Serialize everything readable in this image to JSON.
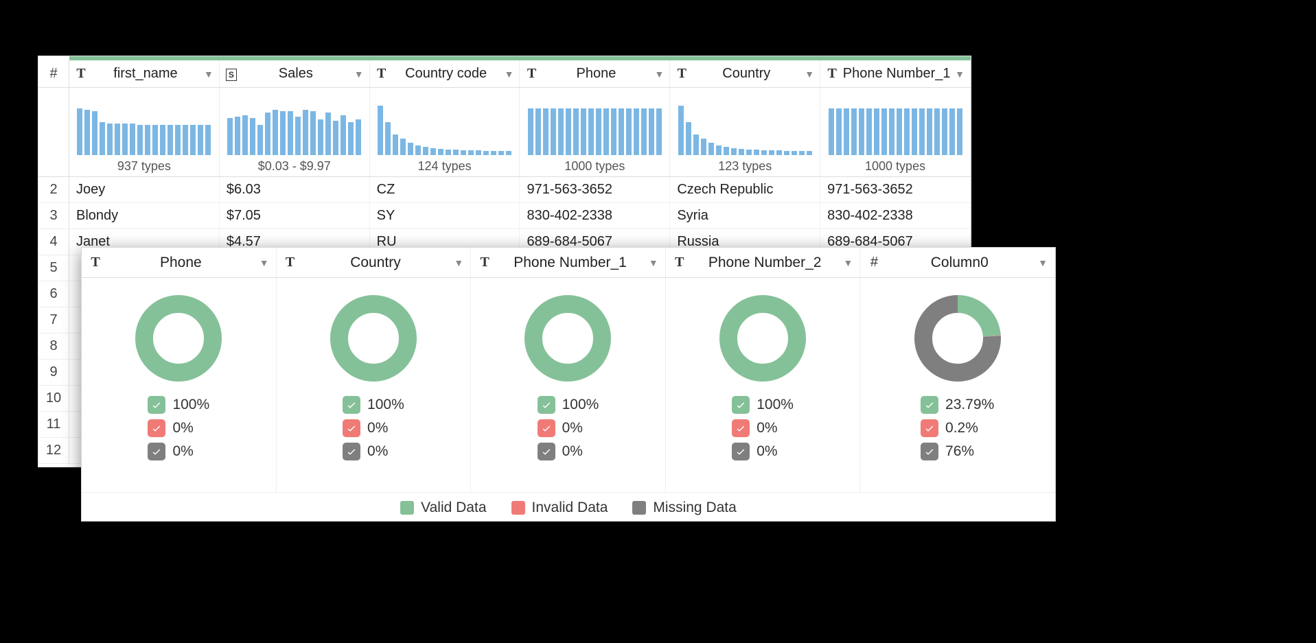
{
  "colors": {
    "valid": "#85c198",
    "invalid": "#f07a75",
    "missing": "#7f7f7f",
    "bar": "#7cb7e4"
  },
  "back": {
    "row_hash": "#",
    "columns": [
      {
        "type": "T",
        "label": "first_name",
        "hist_label": "937 types",
        "hist": [
          68,
          66,
          64,
          48,
          46,
          46,
          46,
          46,
          44,
          44,
          44,
          44,
          44,
          44,
          44,
          44,
          44,
          44
        ]
      },
      {
        "type": "S",
        "label": "Sales",
        "hist_label": "$0.03 - $9.97",
        "hist": [
          54,
          56,
          58,
          54,
          44,
          62,
          66,
          64,
          64,
          56,
          66,
          64,
          52,
          62,
          50,
          58,
          48,
          52
        ]
      },
      {
        "type": "T",
        "label": "Country code",
        "hist_label": "124 types",
        "hist": [
          72,
          48,
          30,
          24,
          18,
          14,
          12,
          10,
          9,
          8,
          8,
          7,
          7,
          7,
          6,
          6,
          6,
          6
        ]
      },
      {
        "type": "T",
        "label": "Phone",
        "hist_label": "1000 types",
        "hist": [
          68,
          68,
          68,
          68,
          68,
          68,
          68,
          68,
          68,
          68,
          68,
          68,
          68,
          68,
          68,
          68,
          68,
          68
        ]
      },
      {
        "type": "T",
        "label": "Country",
        "hist_label": "123 types",
        "hist": [
          72,
          48,
          30,
          24,
          18,
          14,
          12,
          10,
          9,
          8,
          8,
          7,
          7,
          7,
          6,
          6,
          6,
          6
        ]
      },
      {
        "type": "T",
        "label": "Phone Number_1",
        "hist_label": "1000 types",
        "hist": [
          68,
          68,
          68,
          68,
          68,
          68,
          68,
          68,
          68,
          68,
          68,
          68,
          68,
          68,
          68,
          68,
          68,
          68
        ]
      }
    ],
    "rows": [
      {
        "n": "2",
        "cells": [
          "Joey",
          "$6.03",
          "CZ",
          "971-563-3652",
          "Czech Republic",
          "971-563-3652"
        ]
      },
      {
        "n": "3",
        "cells": [
          "Blondy",
          "$7.05",
          "SY",
          "830-402-2338",
          "Syria",
          "830-402-2338"
        ]
      },
      {
        "n": "4",
        "cells": [
          "Janet",
          "$4.57",
          "RU",
          "689-684-5067",
          "Russia",
          "689-684-5067"
        ]
      },
      {
        "n": "5",
        "cells": [
          "",
          "",
          "",
          "",
          "",
          ""
        ]
      },
      {
        "n": "6",
        "cells": [
          "",
          "",
          "",
          "",
          "",
          ""
        ]
      },
      {
        "n": "7",
        "cells": [
          "",
          "",
          "",
          "",
          "",
          ""
        ]
      },
      {
        "n": "8",
        "cells": [
          "",
          "",
          "",
          "",
          "",
          ""
        ]
      },
      {
        "n": "9",
        "cells": [
          "",
          "",
          "",
          "",
          "",
          ""
        ]
      },
      {
        "n": "10",
        "cells": [
          "",
          "",
          "",
          "",
          "",
          ""
        ]
      },
      {
        "n": "11",
        "cells": [
          "",
          "",
          "",
          "",
          "",
          ""
        ]
      },
      {
        "n": "12",
        "cells": [
          "",
          "",
          "",
          "",
          "",
          ""
        ]
      }
    ]
  },
  "front": {
    "columns": [
      {
        "type": "T",
        "label": "Phone",
        "valid": "100%",
        "invalid": "0%",
        "missing": "0%",
        "donut": {
          "valid": 100,
          "invalid": 0,
          "missing": 0
        }
      },
      {
        "type": "T",
        "label": "Country",
        "valid": "100%",
        "invalid": "0%",
        "missing": "0%",
        "donut": {
          "valid": 100,
          "invalid": 0,
          "missing": 0
        }
      },
      {
        "type": "T",
        "label": "Phone Number_1",
        "valid": "100%",
        "invalid": "0%",
        "missing": "0%",
        "donut": {
          "valid": 100,
          "invalid": 0,
          "missing": 0
        }
      },
      {
        "type": "T",
        "label": "Phone Number_2",
        "valid": "100%",
        "invalid": "0%",
        "missing": "0%",
        "donut": {
          "valid": 100,
          "invalid": 0,
          "missing": 0
        }
      },
      {
        "type": "num",
        "label": "Column0",
        "valid": "23.79%",
        "invalid": "0.2%",
        "missing": "76%",
        "donut": {
          "valid": 23.79,
          "invalid": 0.2,
          "missing": 76
        }
      }
    ],
    "legend": {
      "valid": "Valid Data",
      "invalid": "Invalid Data",
      "missing": "Missing Data"
    }
  },
  "chart_data": [
    {
      "type": "bar",
      "title": "first_name distribution",
      "categories_label": "937 types",
      "values": [
        68,
        66,
        64,
        48,
        46,
        46,
        46,
        46,
        44,
        44,
        44,
        44,
        44,
        44,
        44,
        44,
        44,
        44
      ]
    },
    {
      "type": "bar",
      "title": "Sales distribution",
      "categories_label": "$0.03 - $9.97",
      "values": [
        54,
        56,
        58,
        54,
        44,
        62,
        66,
        64,
        64,
        56,
        66,
        64,
        52,
        62,
        50,
        58,
        48,
        52
      ]
    },
    {
      "type": "bar",
      "title": "Country code distribution",
      "categories_label": "124 types",
      "values": [
        72,
        48,
        30,
        24,
        18,
        14,
        12,
        10,
        9,
        8,
        8,
        7,
        7,
        7,
        6,
        6,
        6,
        6
      ]
    },
    {
      "type": "bar",
      "title": "Phone distribution",
      "categories_label": "1000 types",
      "values": [
        68,
        68,
        68,
        68,
        68,
        68,
        68,
        68,
        68,
        68,
        68,
        68,
        68,
        68,
        68,
        68,
        68,
        68
      ]
    },
    {
      "type": "bar",
      "title": "Country distribution",
      "categories_label": "123 types",
      "values": [
        72,
        48,
        30,
        24,
        18,
        14,
        12,
        10,
        9,
        8,
        8,
        7,
        7,
        7,
        6,
        6,
        6,
        6
      ]
    },
    {
      "type": "bar",
      "title": "Phone Number_1 distribution",
      "categories_label": "1000 types",
      "values": [
        68,
        68,
        68,
        68,
        68,
        68,
        68,
        68,
        68,
        68,
        68,
        68,
        68,
        68,
        68,
        68,
        68,
        68
      ]
    },
    {
      "type": "pie",
      "title": "Phone quality",
      "series": [
        {
          "name": "Valid",
          "value": 100
        },
        {
          "name": "Invalid",
          "value": 0
        },
        {
          "name": "Missing",
          "value": 0
        }
      ]
    },
    {
      "type": "pie",
      "title": "Country quality",
      "series": [
        {
          "name": "Valid",
          "value": 100
        },
        {
          "name": "Invalid",
          "value": 0
        },
        {
          "name": "Missing",
          "value": 0
        }
      ]
    },
    {
      "type": "pie",
      "title": "Phone Number_1 quality",
      "series": [
        {
          "name": "Valid",
          "value": 100
        },
        {
          "name": "Invalid",
          "value": 0
        },
        {
          "name": "Missing",
          "value": 0
        }
      ]
    },
    {
      "type": "pie",
      "title": "Phone Number_2 quality",
      "series": [
        {
          "name": "Valid",
          "value": 100
        },
        {
          "name": "Invalid",
          "value": 0
        },
        {
          "name": "Missing",
          "value": 0
        }
      ]
    },
    {
      "type": "pie",
      "title": "Column0 quality",
      "series": [
        {
          "name": "Valid",
          "value": 23.79
        },
        {
          "name": "Invalid",
          "value": 0.2
        },
        {
          "name": "Missing",
          "value": 76
        }
      ]
    }
  ]
}
